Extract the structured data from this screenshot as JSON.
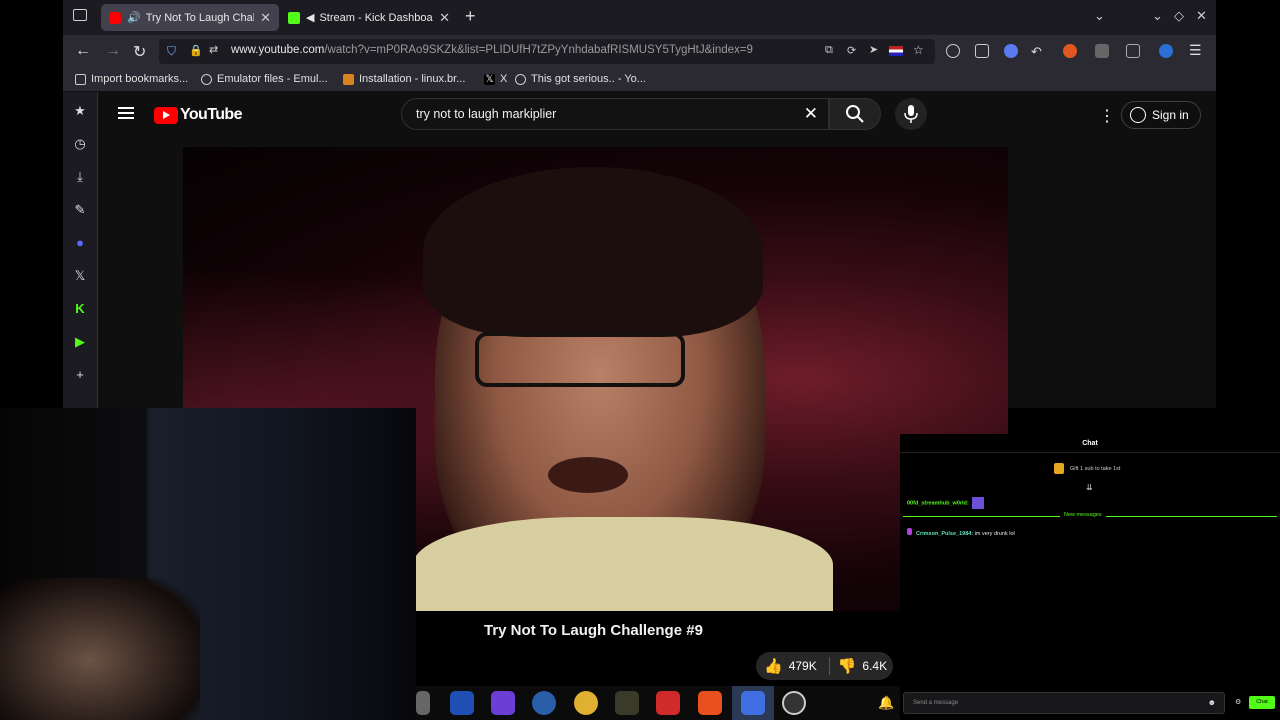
{
  "browser": {
    "tabs": [
      {
        "label": "Try Not To Laugh Challe",
        "active": true,
        "icon": "youtube-icon",
        "audio": "playing"
      },
      {
        "label": "Stream - Kick Dashboar",
        "active": false,
        "icon": "kick-icon",
        "audio": "muted"
      }
    ],
    "url_domain": "www.youtube.com",
    "url_path": "/watch?v=mP0RAo9SKZk&list=PLIDUfH7tZPyYnhdabafRISMUSY5TygHtJ&index=9",
    "bookmarks": [
      {
        "label": "Import bookmarks...",
        "icon": "import-icon"
      },
      {
        "label": "Emulator files - Emul...",
        "icon": "globe-icon"
      },
      {
        "label": "Installation - linux.br...",
        "icon": "b-logo-icon"
      },
      {
        "label": "X",
        "icon": "x-logo-icon"
      },
      {
        "label": "This got serious.. - Yo...",
        "icon": "globe-icon"
      }
    ]
  },
  "youtube": {
    "logo_text": "YouTube",
    "search_query": "try not to laugh markiplier",
    "sign_in_label": "Sign in",
    "video_title": "Try Not To Laugh Challenge #9",
    "likes": "479K",
    "dislikes": "6.4K"
  },
  "chat": {
    "title": "Chat",
    "gift_text": "Gift 1 sub to take 1st",
    "messages": [
      {
        "user": "00fd_streamhub_w0rld:",
        "text": ""
      },
      {
        "user": "Crimson_Pulse_1984:",
        "text": "im very drunk lol"
      }
    ],
    "new_messages_label": "New messages",
    "input_placeholder": "Send a message",
    "send_label": "Chat"
  },
  "colors": {
    "youtube_red": "#ff0000",
    "kick_green": "#53fc18",
    "firefox_tab_bg": "#1c1b22"
  }
}
